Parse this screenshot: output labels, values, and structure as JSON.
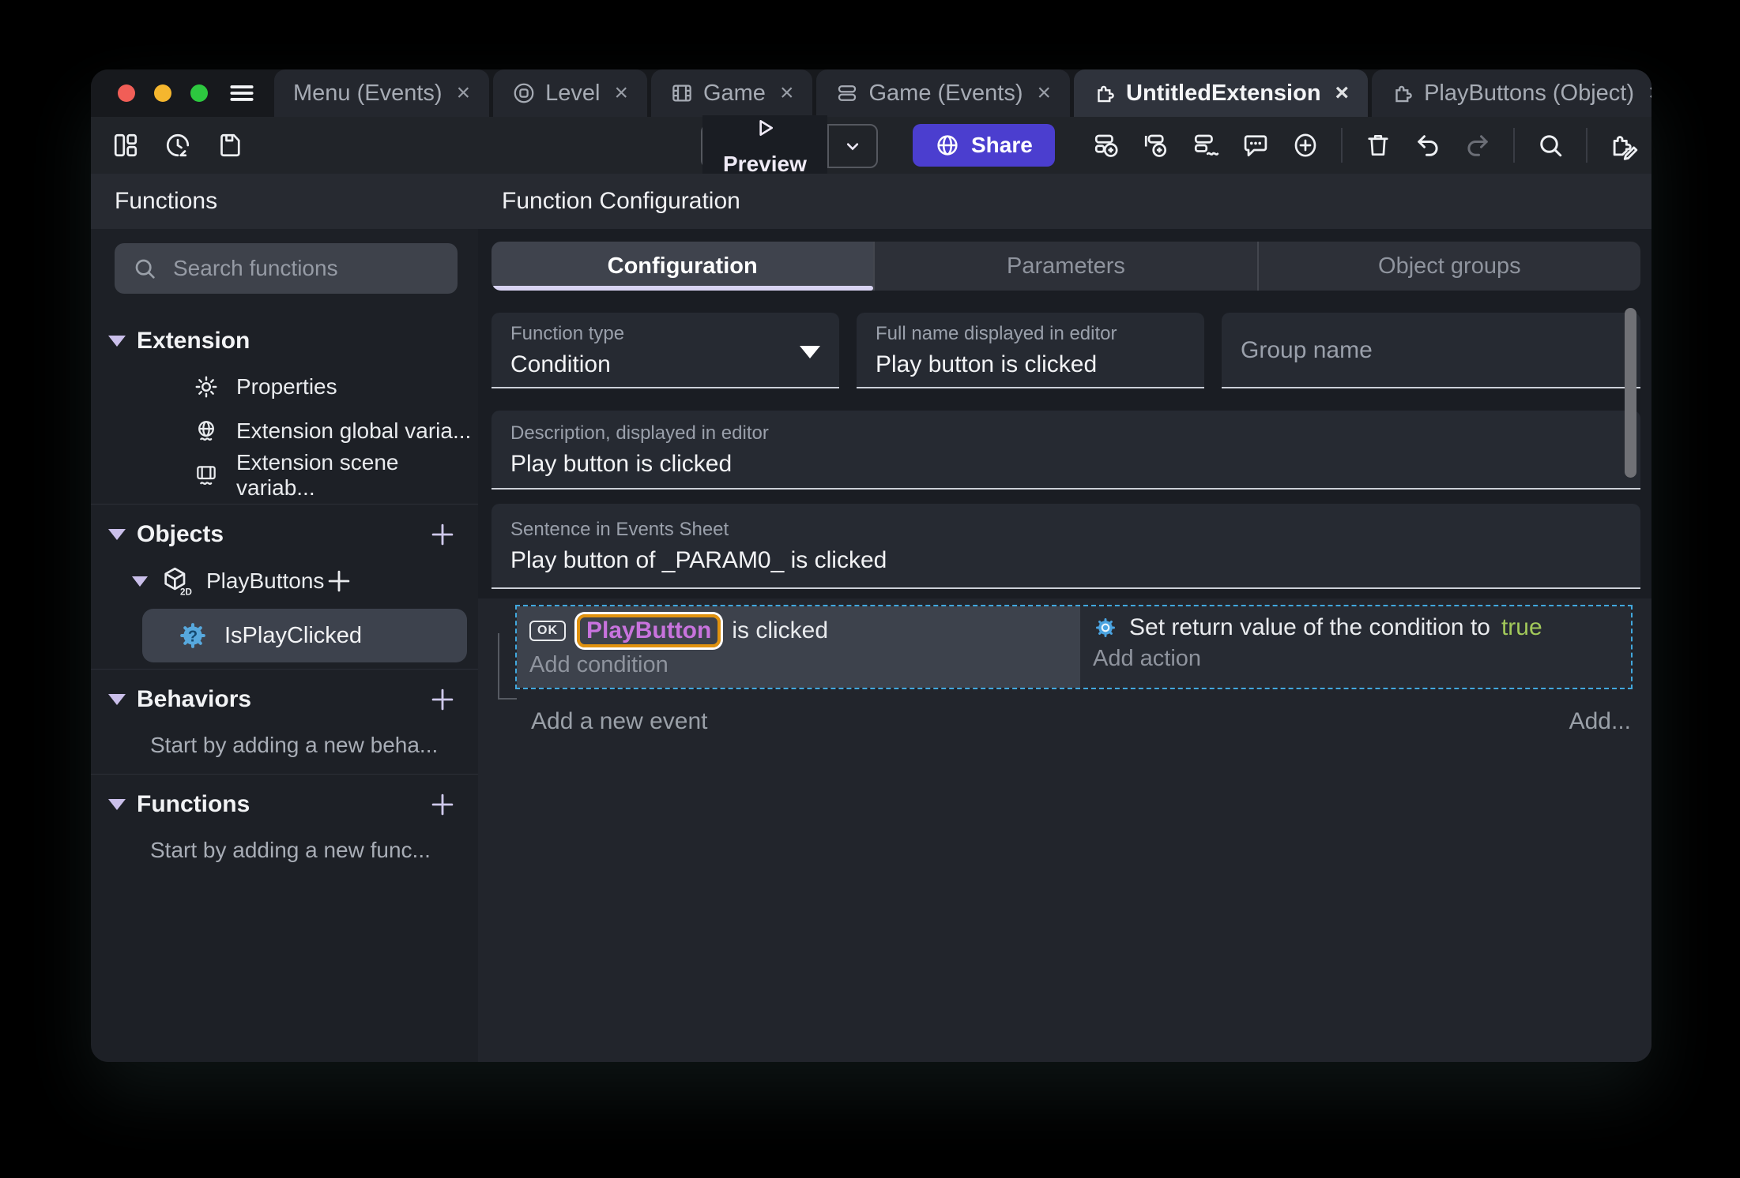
{
  "traffic_lights": {
    "close_color": "#f15e57",
    "minimize_color": "#f5b62e",
    "zoom_color": "#2dc83f"
  },
  "tab_close_glyph": "×",
  "tabs": [
    {
      "label": "Menu (Events)"
    },
    {
      "label": "Level"
    },
    {
      "label": "Game"
    },
    {
      "label": "Game (Events)"
    },
    {
      "label": "UntitledExtension"
    },
    {
      "label": "PlayButtons (Object)"
    }
  ],
  "toolbar": {
    "preview_label": "Preview",
    "share_label": "Share"
  },
  "sidebar": {
    "title": "Functions",
    "search_placeholder": "Search functions",
    "extension_section": "Extension",
    "properties_item": "Properties",
    "global_vars_item": "Extension global varia...",
    "scene_vars_item": "Extension scene variab...",
    "objects_section": "Objects",
    "playbuttons_item": "PlayButtons",
    "cube_badge": "2D",
    "isplayclicked_item": "IsPlayClicked",
    "behaviors_section": "Behaviors",
    "behaviors_empty": "Start by adding a new beha...",
    "functions_section": "Functions",
    "functions_empty": "Start by adding a new func..."
  },
  "config": {
    "panel_title": "Function Configuration",
    "tabs": {
      "configuration": "Configuration",
      "parameters": "Parameters",
      "object_groups": "Object groups"
    },
    "function_type": {
      "label": "Function type",
      "value": "Condition"
    },
    "full_name": {
      "label": "Full name displayed in editor",
      "value": "Play button is clicked"
    },
    "group_name": {
      "placeholder": "Group name"
    },
    "description": {
      "label": "Description, displayed in editor",
      "value": "Play button is clicked"
    },
    "sentence": {
      "label": "Sentence in Events Sheet",
      "value": "Play button of _PARAM0_ is clicked"
    }
  },
  "events": {
    "condition_icon_label": "OK",
    "condition_object": "PlayButton",
    "condition_text": "is clicked",
    "add_condition": "Add condition",
    "action_text": "Set return value of the condition to",
    "action_value": "true",
    "add_action": "Add action",
    "add_new_event": "Add a new event",
    "add_button": "Add..."
  },
  "colors": {
    "accent_purple": "#4b3ecf",
    "lavender_accent": "#d8d3f2",
    "object_name": "#c873dd",
    "selection_border": "#e0920f",
    "boolean_true": "#a2c95a",
    "event_selection": "#41a8de"
  }
}
